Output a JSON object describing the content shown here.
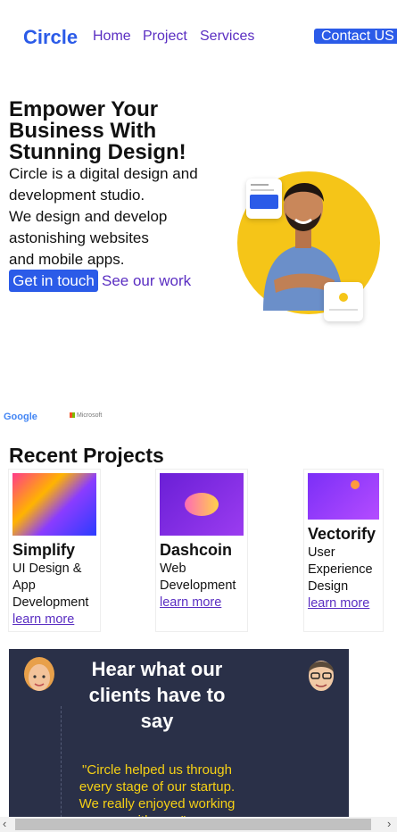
{
  "nav": {
    "logo": "Circle",
    "links": [
      "Home",
      "Project",
      "Services"
    ],
    "contact": "Contact US"
  },
  "hero": {
    "title_lines": [
      "Empower Your",
      "Business With",
      "Stunning Design!"
    ],
    "text_lines": [
      "Circle is a digital design and",
      "development studio.",
      "We design and develop",
      "astonishing websites",
      "and mobile apps."
    ],
    "cta": "Get in touch",
    "secondary": "See our work"
  },
  "partners": {
    "google": "Google",
    "microsoft": "Microsoft"
  },
  "projects": {
    "title": "Recent Projects",
    "items": [
      {
        "name": "Simplify",
        "desc": [
          "UI Design &",
          "App",
          "Development"
        ],
        "link": "learn more"
      },
      {
        "name": "Dashcoin",
        "desc": [
          "Web",
          "Development"
        ],
        "link": "learn more"
      },
      {
        "name": "Vectorify",
        "desc": [
          "User",
          "Experience",
          "Design"
        ],
        "link": "learn more"
      }
    ]
  },
  "testimonial": {
    "title_lines": [
      "Hear what our",
      "clients have to",
      "say"
    ],
    "quote_lines": [
      "\"Circle helped us through",
      "every stage of our startup.",
      "We really enjoyed working",
      "with you.\""
    ]
  },
  "colors": {
    "brand": "#2b5be8",
    "link": "#5a2ec2",
    "accent_yellow": "#f5c518",
    "testimonial_bg": "#2a3048",
    "quote": "#f5d015"
  }
}
